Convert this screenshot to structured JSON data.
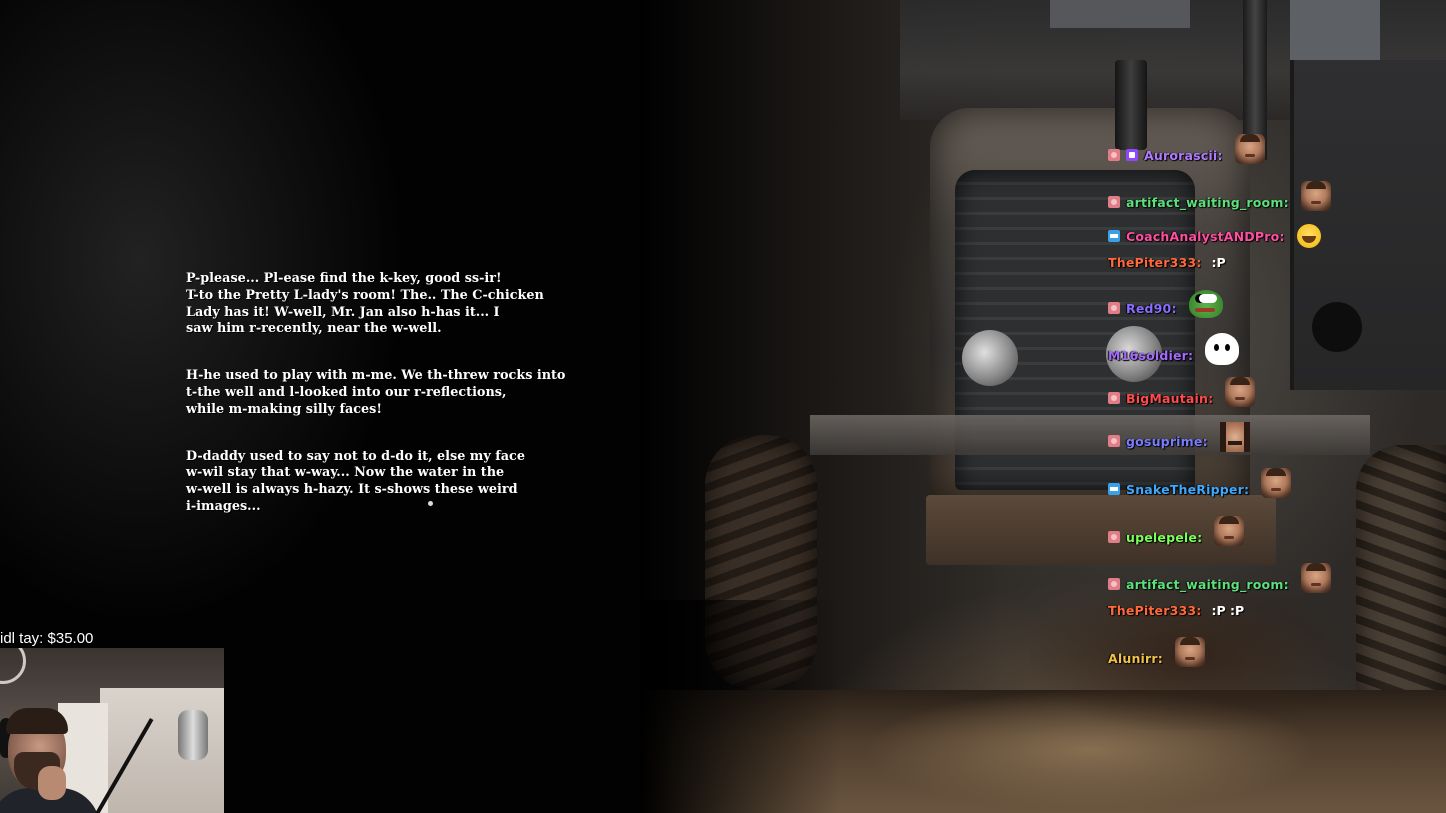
{
  "dialogue": {
    "paragraphs": [
      "P-please... Pl-ease find the k-key, good ss-ir!\nT-to the Pretty L-lady's room! The.. The C-chicken\nLady has it! W-well, Mr. Jan also h-has it... I\nsaw him r-recently, near the w-well.",
      "H-he used to play with m-me. We th-threw rocks into\nt-the well and l-looked into our r-reflections,\nwhile m-making silly faces!",
      "D-daddy used to say not to d-do it, else my face\nw-wil stay that w-way... Now the water in the\nw-well is always h-hazy. It s-shows these weird\ni-images..."
    ]
  },
  "donation_ticker": {
    "text": "idl  tay: $35.00"
  },
  "chat": {
    "messages": [
      {
        "badge": "pink",
        "badge2": "purple",
        "username": "Aurorascii",
        "color": "#b07cff",
        "text": "",
        "emote": "face"
      },
      {
        "badge": "pink",
        "username": "artifact_waiting_room",
        "color": "#5ce07a",
        "text": "",
        "emote": "face"
      },
      {
        "badge": "blue",
        "username": "CoachAnalystANDPro",
        "color": "#ff4fa0",
        "text": "",
        "emote": "laugh"
      },
      {
        "badge": "",
        "username": "ThePiter333",
        "color": "#ff6a3d",
        "text": ":P",
        "emote": ""
      },
      {
        "badge": "pink",
        "username": "Red90",
        "color": "#8a6dff",
        "text": "",
        "emote": "pepe"
      },
      {
        "badge": "",
        "username": "M16soldier",
        "color": "#a36bff",
        "text": "",
        "emote": "ghost"
      },
      {
        "badge": "pink",
        "username": "BigMautain",
        "color": "#ff4b4b",
        "text": "",
        "emote": "face"
      },
      {
        "badge": "pink",
        "username": "gosuprime",
        "color": "#7a7dff",
        "text": "",
        "emote": "pixel"
      },
      {
        "badge": "blue",
        "username": "SnakeTheRipper",
        "color": "#3fa9ff",
        "text": "",
        "emote": "face"
      },
      {
        "badge": "pink",
        "username": "upelepele",
        "color": "#7dff5a",
        "text": "",
        "emote": "face"
      },
      {
        "badge": "pink",
        "username": "artifact_waiting_room",
        "color": "#5ce07a",
        "text": "",
        "emote": "face"
      },
      {
        "badge": "",
        "username": "ThePiter333",
        "color": "#ff6a3d",
        "text": ":P :P",
        "emote": ""
      },
      {
        "badge": "",
        "username": "Alunirr",
        "color": "#f2c24a",
        "text": "",
        "emote": "face"
      }
    ]
  }
}
